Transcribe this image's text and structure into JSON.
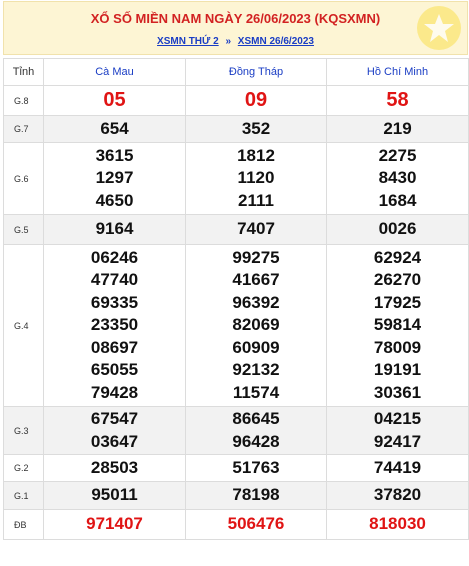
{
  "header": {
    "title": "XỔ SỐ MIỀN NAM NGÀY 26/06/2023 (KQSXMN)",
    "link1": "XSMN THỨ 2",
    "separator": "»",
    "link2": "XSMN 26/6/2023",
    "badge_icon": "star-icon"
  },
  "table": {
    "col_label": "Tỉnh",
    "provinces": [
      "Cà Mau",
      "Đồng Tháp",
      "Hồ Chí Minh"
    ],
    "prizes": [
      {
        "label": "G.8",
        "values": [
          [
            "05"
          ],
          [
            "09"
          ],
          [
            "58"
          ]
        ]
      },
      {
        "label": "G.7",
        "values": [
          [
            "654"
          ],
          [
            "352"
          ],
          [
            "219"
          ]
        ]
      },
      {
        "label": "G.6",
        "values": [
          [
            "3615",
            "1297",
            "4650"
          ],
          [
            "1812",
            "1120",
            "2111"
          ],
          [
            "2275",
            "8430",
            "1684"
          ]
        ]
      },
      {
        "label": "G.5",
        "values": [
          [
            "9164"
          ],
          [
            "7407"
          ],
          [
            "0026"
          ]
        ]
      },
      {
        "label": "G.4",
        "values": [
          [
            "06246",
            "47740",
            "69335",
            "23350",
            "08697",
            "65055",
            "79428"
          ],
          [
            "99275",
            "41667",
            "96392",
            "82069",
            "60909",
            "92132",
            "11574"
          ],
          [
            "62924",
            "26270",
            "17925",
            "59814",
            "78009",
            "19191",
            "30361"
          ]
        ]
      },
      {
        "label": "G.3",
        "values": [
          [
            "67547",
            "03647"
          ],
          [
            "86645",
            "96428"
          ],
          [
            "04215",
            "92417"
          ]
        ]
      },
      {
        "label": "G.2",
        "values": [
          [
            "28503"
          ],
          [
            "51763"
          ],
          [
            "74419"
          ]
        ]
      },
      {
        "label": "G.1",
        "values": [
          [
            "95011"
          ],
          [
            "78198"
          ],
          [
            "37820"
          ]
        ]
      },
      {
        "label": "ĐB",
        "values": [
          [
            "971407"
          ],
          [
            "506476"
          ],
          [
            "818030"
          ]
        ]
      }
    ]
  },
  "colors": {
    "title_red": "#d22222",
    "link_blue": "#1a3dc4",
    "header_bg": "#fdf5d4",
    "shade_row": "#f2f2f2"
  }
}
